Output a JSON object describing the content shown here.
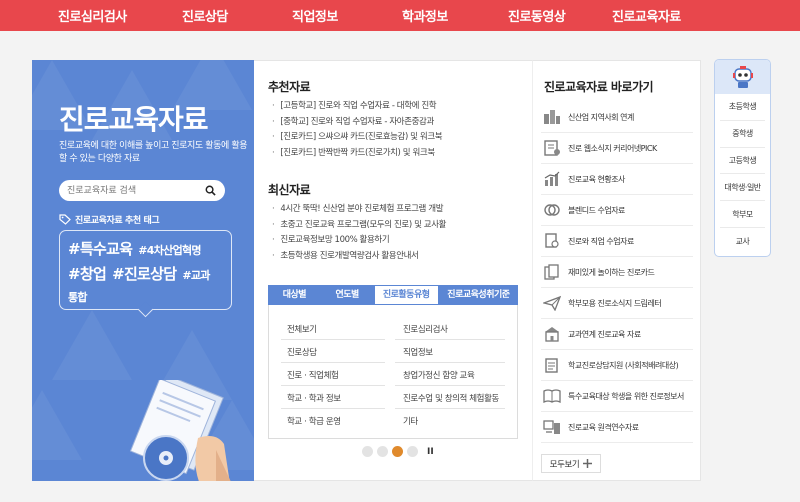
{
  "topnav": [
    "진로심리검사",
    "진로상담",
    "직업정보",
    "학과정보",
    "진로동영상",
    "진로교육자료"
  ],
  "hero": {
    "title": "진로교육자료",
    "desc": "진로교육에 대한 이해를 높이고 진로지도 활동에 활용할 수 있는 다양한 자료",
    "search_placeholder": "진로교육자료 검색",
    "tag_head": "진로교육자료 추천 태그",
    "tags": [
      {
        "text": "#특수교육",
        "size": "big"
      },
      {
        "text": "#4차산업혁명",
        "size": "sm"
      },
      {
        "text": "#창업",
        "size": "big"
      },
      {
        "text": "#진로상담",
        "size": "big"
      },
      {
        "text": "#교과",
        "size": "sm"
      },
      {
        "text": "통합",
        "size": "sm"
      }
    ]
  },
  "recommended": {
    "title": "추천자료",
    "items": [
      "[고등학교] 진로와 직업 수업자료 - 대학에 진학",
      "[중학교] 진로와 직업 수업자료 - 자아존중감과",
      "[진로카드] 으쌰으쌰 카드(진로효능감) 및 워크북",
      "[진로카드] 반짝반짝 카드(진로가치) 및 워크북"
    ]
  },
  "latest": {
    "title": "최신자료",
    "items": [
      "4시간 뚝딱! 신산업 분야 진로체험 프로그램 개발",
      "초중고 진로교육 프로그램(모두의 진로) 및 교사활",
      "진로교육정보망 100% 활용하기",
      "초등학생용 진로개발역량검사 활용안내서"
    ]
  },
  "tabs": [
    "대상별",
    "연도별",
    "진로활동유형",
    "진로교육성취기준"
  ],
  "active_tab": 2,
  "categories": [
    [
      "전체보기",
      "진로심리검사"
    ],
    [
      "진로상담",
      "직업정보"
    ],
    [
      "진로 · 직업체험",
      "창업가정신 함양 교육"
    ],
    [
      "학교 · 학과 정보",
      "진로수업 및 창의적 체험활동"
    ],
    [
      "학교 · 학급 운영",
      "기타"
    ]
  ],
  "pager": {
    "count": 4,
    "active": 2,
    "pause": "II"
  },
  "shortcuts": {
    "title": "진로교육자료 바로가기",
    "items": [
      {
        "label": "신산업 지역사회 연계",
        "icon": "city-icon"
      },
      {
        "label": "진로 웹소식지 커리어넷PICK",
        "icon": "newsletter-icon"
      },
      {
        "label": "진로교육 현황조사",
        "icon": "chart-icon"
      },
      {
        "label": "블렌디드 수업자료",
        "icon": "blend-icon"
      },
      {
        "label": "진로와 직업 수업자료",
        "icon": "document-icon"
      },
      {
        "label": "재미있게 놀이하는 진로카드",
        "icon": "cards-icon"
      },
      {
        "label": "학부모용 진로소식지 드림레터",
        "icon": "paper-plane-icon"
      },
      {
        "label": "교과연계 진로교육 자료",
        "icon": "school-icon"
      },
      {
        "label": "학교진로상담지원 (사회적배려대상)",
        "icon": "notepad-icon"
      },
      {
        "label": "특수교육대상 학생을 위한 진로정보서",
        "icon": "book-icon"
      },
      {
        "label": "진로교육 원격연수자료",
        "icon": "monitor-icon"
      }
    ],
    "more": "모두보기",
    "more_icon": "plus-icon"
  },
  "quick": [
    "초등학생",
    "중학생",
    "고등학생",
    "대학생·일반",
    "학부모",
    "교사"
  ],
  "colors": {
    "nav": "#e8474c",
    "hero": "#5b86d4",
    "active_dot": "#e08a2c"
  }
}
